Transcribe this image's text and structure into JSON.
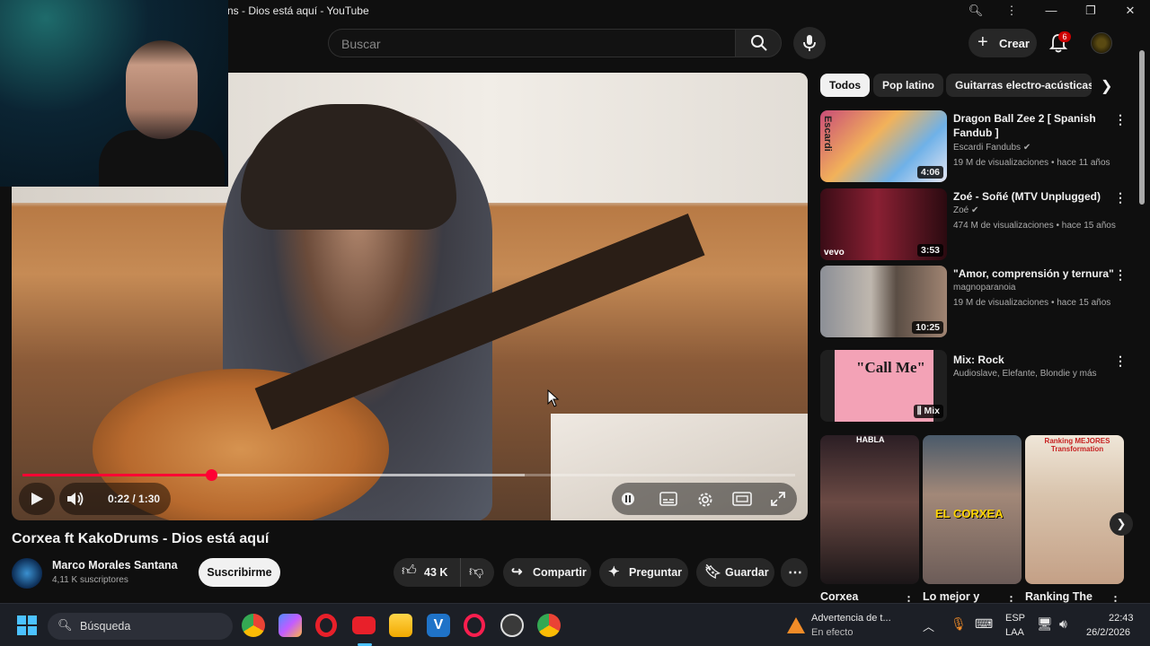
{
  "window": {
    "title": "ns - Dios está aquí - YouTube"
  },
  "header": {
    "search_placeholder": "Buscar",
    "create_label": "Crear",
    "notif_count": "6"
  },
  "player": {
    "time": "0:22 / 1:30",
    "progress": 0.2444,
    "buffered": 0.65
  },
  "video": {
    "title": "Corxea ft KakoDrums - Dios está aquí",
    "channel": "Marco Morales Santana",
    "subscribers": "4,11 K suscriptores",
    "subscribe_label": "Suscribirme",
    "likes": "43 K",
    "share_label": "Compartir",
    "ask_label": "Preguntar",
    "save_label": "Guardar"
  },
  "chips": [
    "Todos",
    "Pop latino",
    "Guitarras electro-acústicas"
  ],
  "recommendations": [
    {
      "title": "Dragon Ball Zee 2 [ Spanish Fandub ]",
      "channel": "Escardi Fandubs",
      "meta": "19 M de visualizaciones • hace 11 años",
      "duration": "4:06",
      "thumb_text": "Escardi"
    },
    {
      "title": "Zoé - Soñé (MTV Unplugged)",
      "channel": "Zoé",
      "meta": "474 M de visualizaciones • hace 15 años",
      "duration": "3:53",
      "thumb_text": "vevo"
    },
    {
      "title": "\"Amor, comprensión y ternura\"",
      "channel": "magnoparanoia",
      "meta": "19 M de visualizaciones • hace 15 años",
      "duration": "10:25"
    },
    {
      "title": "Mix: Rock",
      "channel": "Audioslave, Elefante, Blondie y más",
      "meta": "",
      "duration": "Mix",
      "thumb_text": "\"Call Me\""
    }
  ],
  "shorts": [
    {
      "title": "Corxea",
      "overlay": "HABLA"
    },
    {
      "title": "Lo mejor y",
      "overlay": "EL CORXEA"
    },
    {
      "title": "Ranking The",
      "overlay": "Ranking MEJORES Transformation"
    }
  ],
  "taskbar": {
    "search_label": "Búsqueda",
    "alert_title": "Advertencia de t...",
    "alert_sub": "En efecto",
    "lang_top": "ESP",
    "lang_bottom": "LAA",
    "time": "22:43",
    "date": "26/2/2026"
  },
  "colors": {
    "accent": "#ff0033",
    "background": "#0f0f0f",
    "chip": "#272727"
  }
}
